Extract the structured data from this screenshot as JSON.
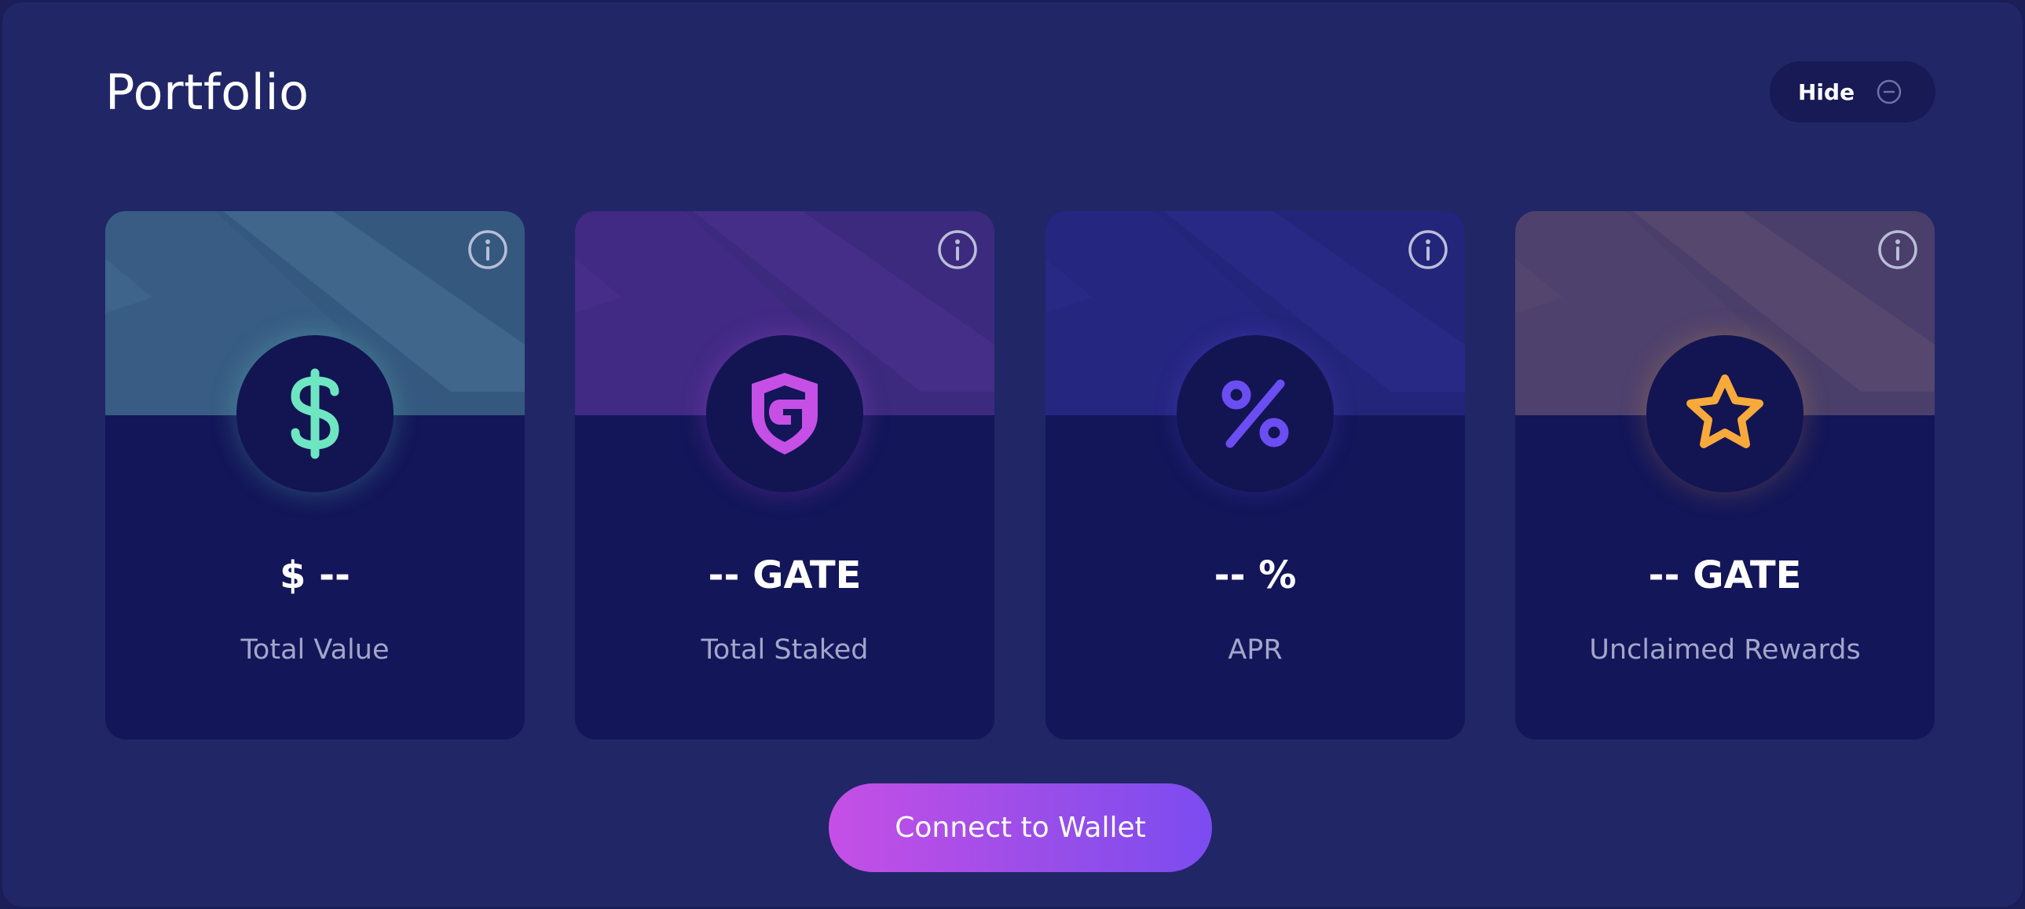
{
  "header": {
    "title": "Portfolio",
    "hide_label": "Hide",
    "hide_icon": "minus-circle-icon"
  },
  "cards": [
    {
      "value": "$ --",
      "label": "Total Value",
      "icon": "dollar-icon",
      "accent": "#6ee6c2",
      "banner": "#3d6791"
    },
    {
      "value": "-- GATE",
      "label": "Total Staked",
      "icon": "shield-g-icon",
      "accent": "#c64fe6",
      "banner": "#3f2e84"
    },
    {
      "value": "-- %",
      "label": "APR",
      "icon": "percent-icon",
      "accent": "#6a4ef2",
      "banner": "#252a7e"
    },
    {
      "value": "-- GATE",
      "label": "Unclaimed Rewards",
      "icon": "star-icon",
      "accent": "#f7a93b",
      "banner": "#5a4a72"
    }
  ],
  "footer": {
    "connect_label": "Connect to Wallet"
  }
}
